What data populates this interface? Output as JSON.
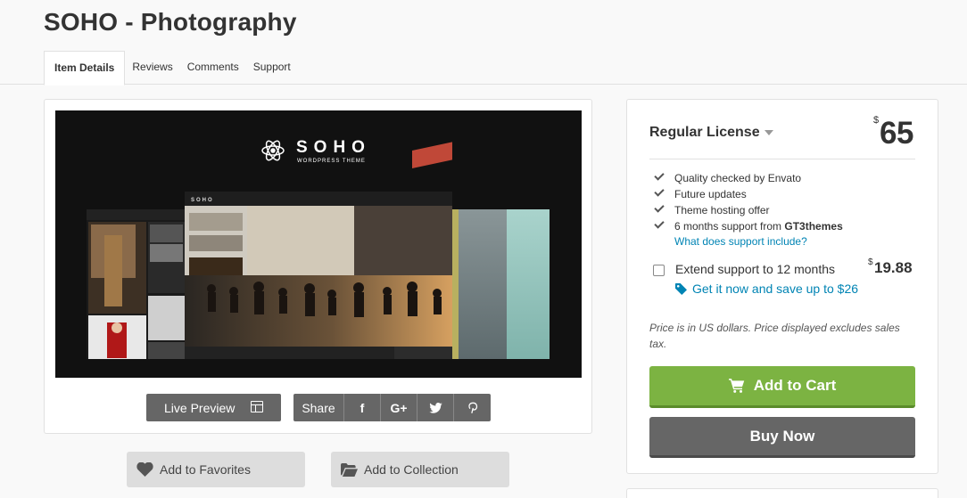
{
  "page": {
    "title": "SOHO - Photography"
  },
  "tabs": [
    {
      "label": "Item Details",
      "active": true
    },
    {
      "label": "Reviews"
    },
    {
      "label": "Comments"
    },
    {
      "label": "Support"
    }
  ],
  "preview": {
    "logo_text": "SOHO",
    "logo_sub": "WORDPRESS THEME",
    "live_preview_label": "Live Preview",
    "share_label": "Share",
    "social": [
      "f",
      "G+",
      "twitter",
      "pinterest"
    ]
  },
  "actions": {
    "favorites_label": "Add to Favorites",
    "collection_label": "Add to Collection"
  },
  "license": {
    "name": "Regular License",
    "currency": "$",
    "price": "65",
    "features": [
      "Quality checked by Envato",
      "Future updates",
      "Theme hosting offer"
    ],
    "support_prefix": "6 months support from ",
    "support_author": "GT3themes",
    "support_link": "What does support include?",
    "extend_label": "Extend support to 12 months",
    "extend_currency": "$",
    "extend_price": "19.88",
    "extend_save": "Get it now and save up to $26",
    "price_note": "Price is in US dollars. Price displayed excludes sales tax.",
    "add_to_cart": "Add to Cart",
    "buy_now": "Buy Now"
  },
  "colors": {
    "accent_green": "#7cb342",
    "link_blue": "#0084b4",
    "button_gray": "#666666"
  }
}
